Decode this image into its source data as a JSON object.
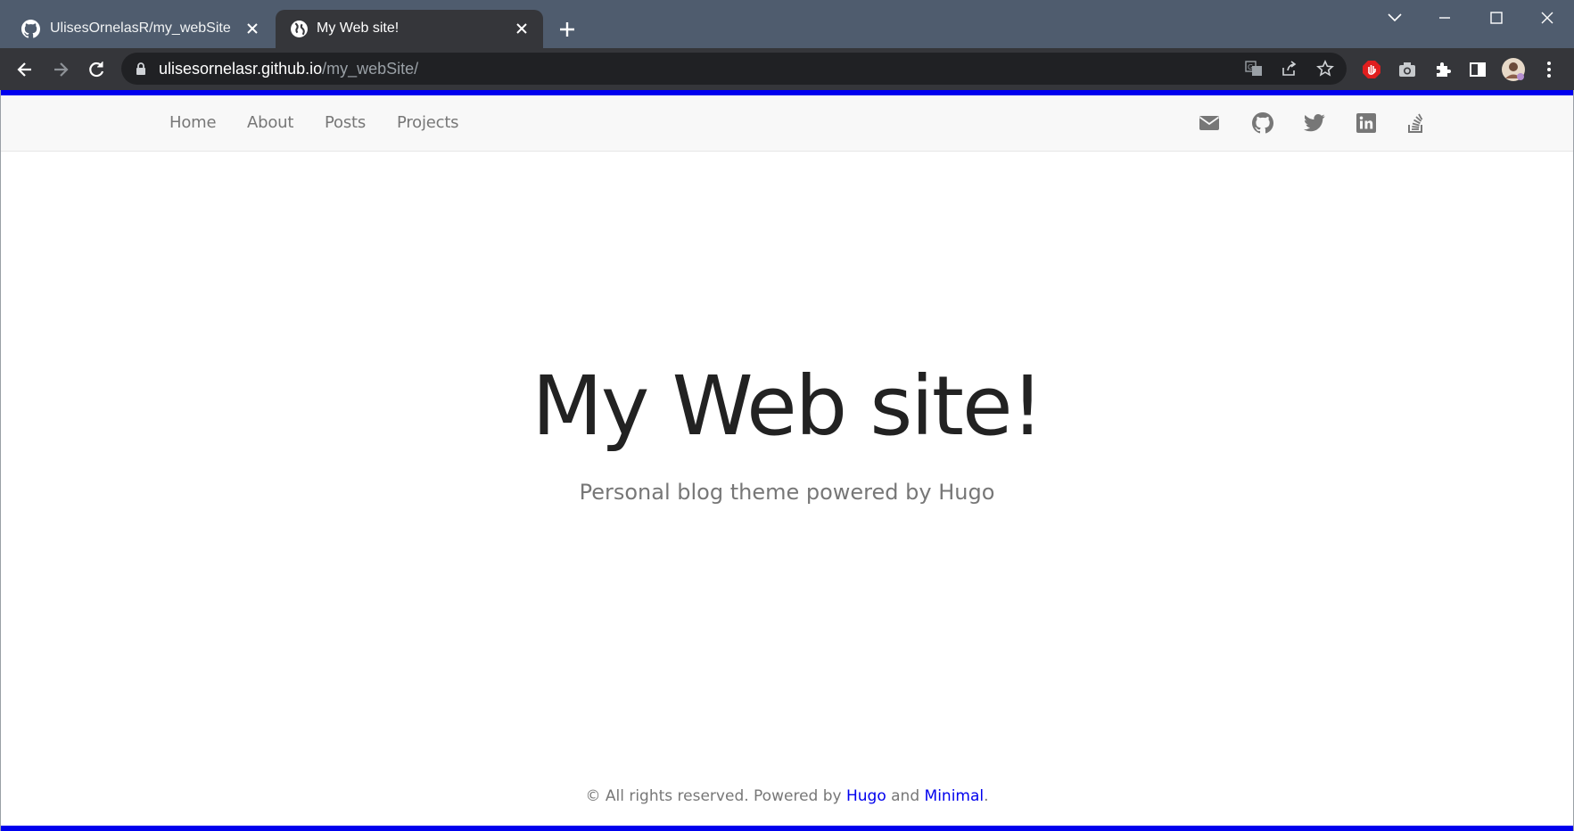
{
  "browser": {
    "tabs": [
      {
        "title": "UlisesOrnelasR/my_webSite",
        "favicon": "github-icon",
        "active": false
      },
      {
        "title": "My Web site!",
        "favicon": "globe-icon",
        "active": true
      }
    ],
    "address": {
      "host": "ulisesornelasr.github.io",
      "path": "/my_webSite/"
    }
  },
  "site": {
    "nav": [
      "Home",
      "About",
      "Posts",
      "Projects"
    ],
    "social": [
      "mail-icon",
      "github-icon",
      "twitter-icon",
      "linkedin-icon",
      "stackoverflow-icon"
    ],
    "title": "My Web site!",
    "subtitle": "Personal blog theme powered by Hugo",
    "footer": {
      "prefix": "© All rights reserved. Powered by",
      "link1": "Hugo",
      "middle": "and",
      "link2": "Minimal",
      "suffix": "."
    }
  },
  "colors": {
    "accent": "#0000ee",
    "tabstrip": "#4f5c6e",
    "toolbar": "#35363a",
    "nav_bg": "#f8f8f8",
    "nav_text": "#777777",
    "title_text": "#222222"
  }
}
